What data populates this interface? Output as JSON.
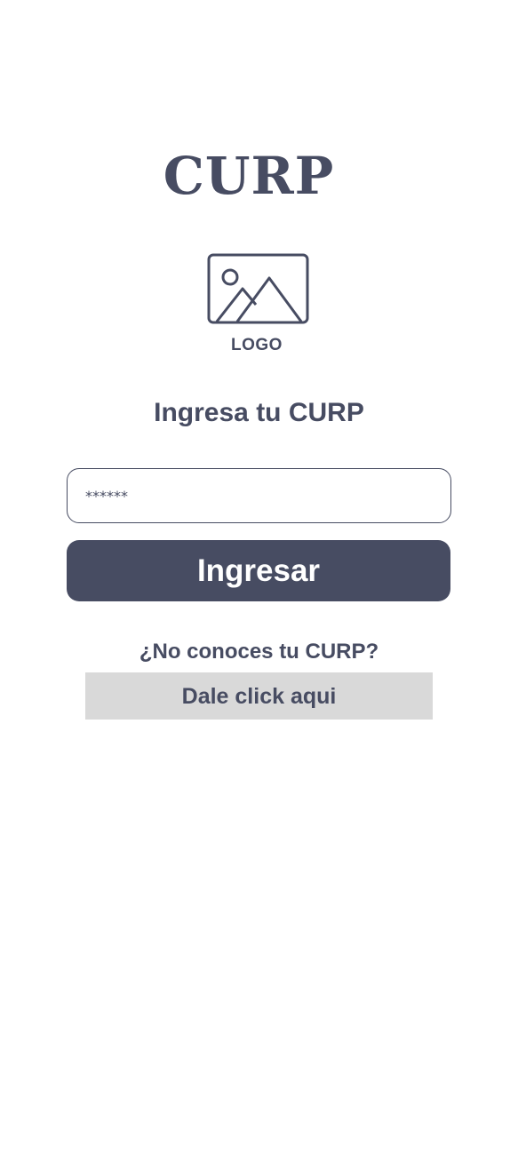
{
  "header": {
    "title": "CURP"
  },
  "logo": {
    "icon": "image-placeholder-icon",
    "label": "LOGO"
  },
  "form": {
    "heading": "Ingresa tu CURP",
    "input_placeholder": "******",
    "submit_label": "Ingresar"
  },
  "help": {
    "question": "¿No conoces tu CURP?",
    "link_label": "Dale click aqui"
  },
  "colors": {
    "primary": "#474c62",
    "link_background": "#d9d9d9",
    "background": "#ffffff"
  }
}
